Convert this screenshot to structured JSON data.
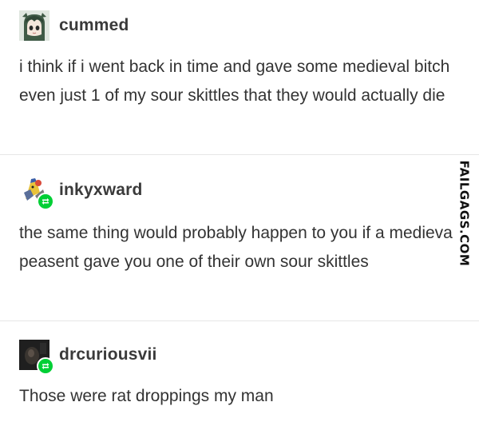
{
  "posts": [
    {
      "username": "cummed",
      "avatar_icon": "anime-girl-avatar-icon",
      "reblogged": false,
      "text": "i think if i went back in time and gave some medieval bitch even just 1 of my sour skittles that they would actually die"
    },
    {
      "username": "inkyxward",
      "avatar_icon": "cartoon-character-avatar-icon",
      "reblogged": true,
      "text": "the same thing would probably happen to you if a medieval peasent gave you one of their own sour skittles"
    },
    {
      "username": "drcuriousvii",
      "avatar_icon": "dark-photo-avatar-icon",
      "reblogged": true,
      "text": "Those were rat droppings my man"
    }
  ],
  "watermark": "FAILGAGS.COM",
  "colors": {
    "reblog_badge": "#00cf35",
    "divider": "#e6e6e6",
    "text": "#333333"
  }
}
